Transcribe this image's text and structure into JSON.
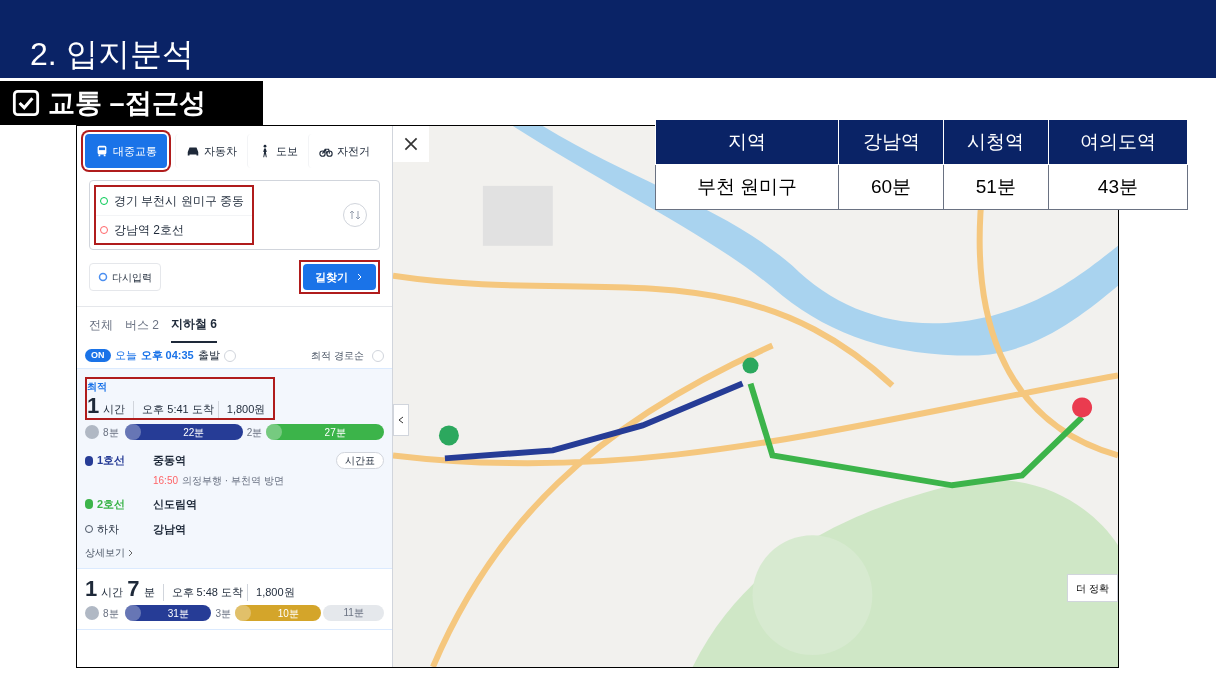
{
  "slide_title": "2. 입지분석",
  "section_label": "교통 –접근성",
  "mode_tabs": [
    {
      "label": "대중교통",
      "kind": "bus",
      "selected": true
    },
    {
      "label": "자동차",
      "kind": "car",
      "selected": false
    },
    {
      "label": "도보",
      "kind": "walk",
      "selected": false
    },
    {
      "label": "자전거",
      "kind": "bike",
      "selected": false
    }
  ],
  "origin": "경기 부천시 원미구 중동",
  "destination": "강남역 2호선",
  "reset_button": "다시입력",
  "search_button": "길찾기",
  "result_tabs": [
    {
      "label": "전체",
      "selected": false
    },
    {
      "label": "버스 2",
      "selected": false
    },
    {
      "label": "지하철 6",
      "selected": true
    }
  ],
  "departure": {
    "toggle": "ON",
    "on": true,
    "day": "오늘",
    "time": "오후 04:35",
    "suffix": "출발"
  },
  "sort": "최적 경로순",
  "routes": [
    {
      "badge": "최적",
      "hours": "1",
      "hours_unit": "시간",
      "arrival": "오후 5:41 도착",
      "fare": "1,800원",
      "expanded": true,
      "segments": [
        {
          "kind": "walk",
          "label": "8분",
          "color": "#b0b8c4"
        },
        {
          "kind": "train",
          "label": "22분",
          "color": "#263c96"
        },
        {
          "kind": "gap",
          "label": "2분"
        },
        {
          "kind": "train",
          "label": "27분",
          "color": "#3cb44a"
        }
      ],
      "steps": [
        {
          "kind": "line",
          "line": "1호선",
          "color": "#263c96",
          "station": "중동역",
          "detail_time": "16:50",
          "detail": "의정부행 · 부천역 방면",
          "button": "시간표"
        },
        {
          "kind": "line",
          "line": "2호선",
          "color": "#3cb44a",
          "station": "신도림역"
        },
        {
          "kind": "exit",
          "line": "하차",
          "station": "강남역"
        }
      ],
      "more": "상세보기"
    },
    {
      "hours": "1",
      "hours_unit": "시간",
      "minutes": "7",
      "minutes_unit": "분",
      "arrival": "오후 5:48 도착",
      "fare": "1,800원",
      "expanded": false,
      "segments": [
        {
          "kind": "walk",
          "label": "8분",
          "color": "#b0b8c4"
        },
        {
          "kind": "train",
          "label": "31분",
          "color": "#263c96"
        },
        {
          "kind": "gap",
          "label": "3분"
        },
        {
          "kind": "train",
          "label": "10분",
          "color": "#d4a52a"
        },
        {
          "kind": "rest",
          "label": "11분",
          "color": "#e5e8ec"
        }
      ]
    }
  ],
  "map_button": "더 정확",
  "table": {
    "columns": [
      "지역",
      "강남역",
      "시청역",
      "여의도역"
    ],
    "rows": [
      [
        "부천 원미구",
        "60분",
        "51분",
        "43분"
      ]
    ]
  }
}
